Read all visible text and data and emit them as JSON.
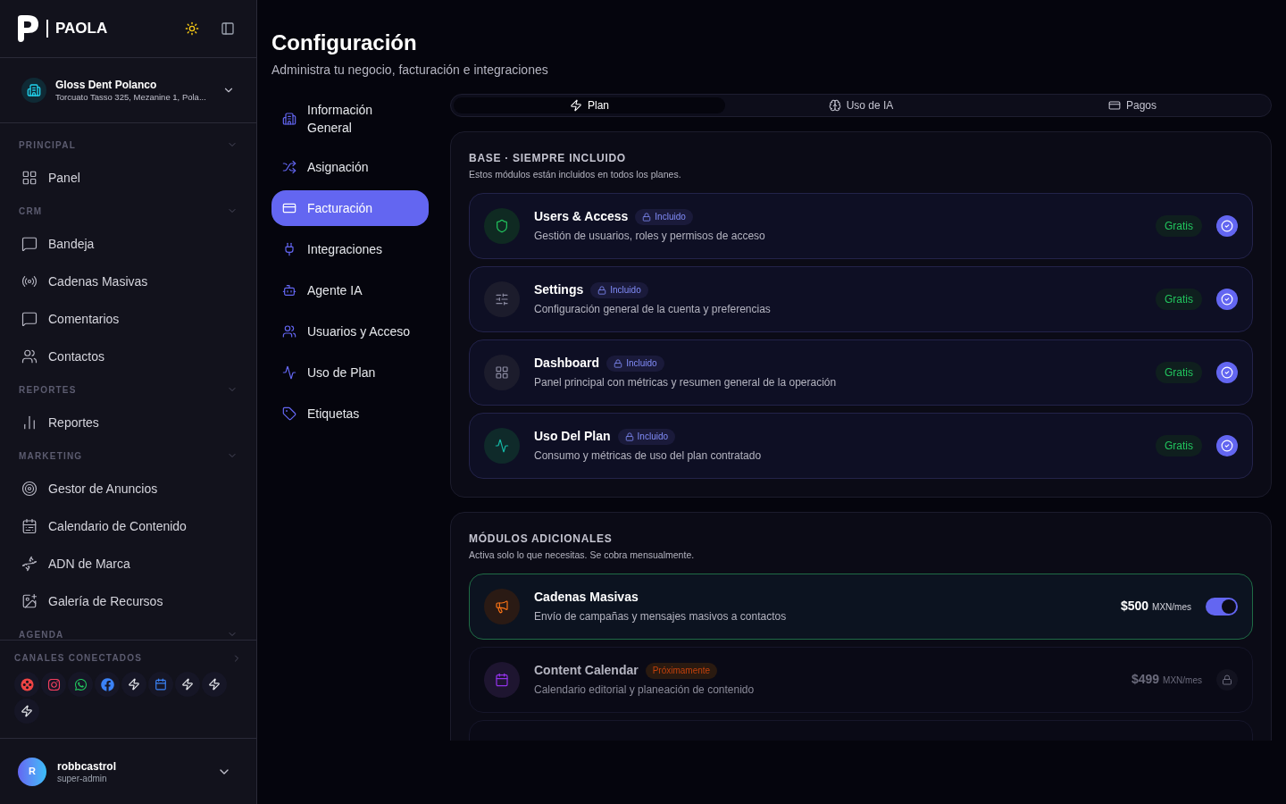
{
  "brand": {
    "name": "PAOLA"
  },
  "business": {
    "name": "Gloss Dent Polanco",
    "address": "Torcuato Tasso 325, Mezanine 1, Pola..."
  },
  "nav_groups": [
    {
      "title": "PRINCIPAL",
      "expanded": true,
      "items": [
        {
          "label": "Panel"
        }
      ]
    },
    {
      "title": "CRM",
      "expanded": true,
      "items": [
        {
          "label": "Bandeja"
        },
        {
          "label": "Cadenas Masivas"
        },
        {
          "label": "Comentarios"
        },
        {
          "label": "Contactos"
        }
      ]
    },
    {
      "title": "REPORTES",
      "expanded": true,
      "items": [
        {
          "label": "Reportes"
        }
      ]
    },
    {
      "title": "MARKETING",
      "expanded": true,
      "items": [
        {
          "label": "Gestor de Anuncios"
        },
        {
          "label": "Calendario de Contenido"
        },
        {
          "label": "ADN de Marca"
        },
        {
          "label": "Galería de Recursos"
        }
      ]
    },
    {
      "title": "AGENDA",
      "expanded": true
    }
  ],
  "channels": {
    "title": "CANALES CONECTADOS",
    "expanded": false,
    "items": [
      {
        "kind": "dots"
      },
      {
        "kind": "instagram"
      },
      {
        "kind": "whatsapp"
      },
      {
        "kind": "facebook"
      },
      {
        "kind": "zap"
      },
      {
        "kind": "calendar"
      },
      {
        "kind": "zap"
      },
      {
        "kind": "zap"
      },
      {
        "kind": "zap"
      }
    ]
  },
  "user": {
    "initial": "R",
    "name": "robbcastrol",
    "role": "super-admin"
  },
  "page": {
    "title": "Configuración",
    "subtitle": "Administra tu negocio, facturación e integraciones"
  },
  "settings_menu": [
    {
      "label": "Información General",
      "selected": false
    },
    {
      "label": "Asignación",
      "selected": false
    },
    {
      "label": "Facturación",
      "selected": true
    },
    {
      "label": "Integraciones",
      "selected": false
    },
    {
      "label": "Agente IA",
      "selected": false
    },
    {
      "label": "Usuarios y Acceso",
      "selected": false
    },
    {
      "label": "Uso de Plan",
      "selected": false
    },
    {
      "label": "Etiquetas",
      "selected": false
    }
  ],
  "tabs": [
    {
      "label": "Plan",
      "selected": true
    },
    {
      "label": "Uso de IA",
      "selected": false
    },
    {
      "label": "Pagos",
      "selected": false
    }
  ],
  "base_section": {
    "title": "BASE · SIEMPRE INCLUIDO",
    "subtitle": "Estos módulos están incluidos en todos los planes.",
    "modules": [
      {
        "name": "Users & Access",
        "badge": "Incluido",
        "description": "Gestión de usuarios, roles y permisos de acceso",
        "price": "Gratis",
        "checked": true
      },
      {
        "name": "Settings",
        "badge": "Incluido",
        "description": "Configuración general de la cuenta y preferencias",
        "price": "Gratis",
        "checked": true
      },
      {
        "name": "Dashboard",
        "badge": "Incluido",
        "description": "Panel principal con métricas y resumen general de la operación",
        "price": "Gratis",
        "checked": true
      },
      {
        "name": "Uso Del Plan",
        "badge": "Incluido",
        "description": "Consumo y métricas de uso del plan contratado",
        "price": "Gratis",
        "checked": true
      }
    ]
  },
  "addons_section": {
    "title": "MÓDULOS ADICIONALES",
    "subtitle": "Activa solo lo que necesitas. Se cobra mensualmente.",
    "modules": [
      {
        "kind": "toggle",
        "name": "Cadenas Masivas",
        "description": "Envío de campañas y mensajes masivos a contactos",
        "price": "$500",
        "unit": "MXN/mes",
        "on": true
      },
      {
        "kind": "locked",
        "name": "Content Calendar",
        "badge": "Próximamente",
        "description": "Calendario editorial y planeación de contenido",
        "price": "$499",
        "unit": "MXN/mes"
      }
    ]
  }
}
